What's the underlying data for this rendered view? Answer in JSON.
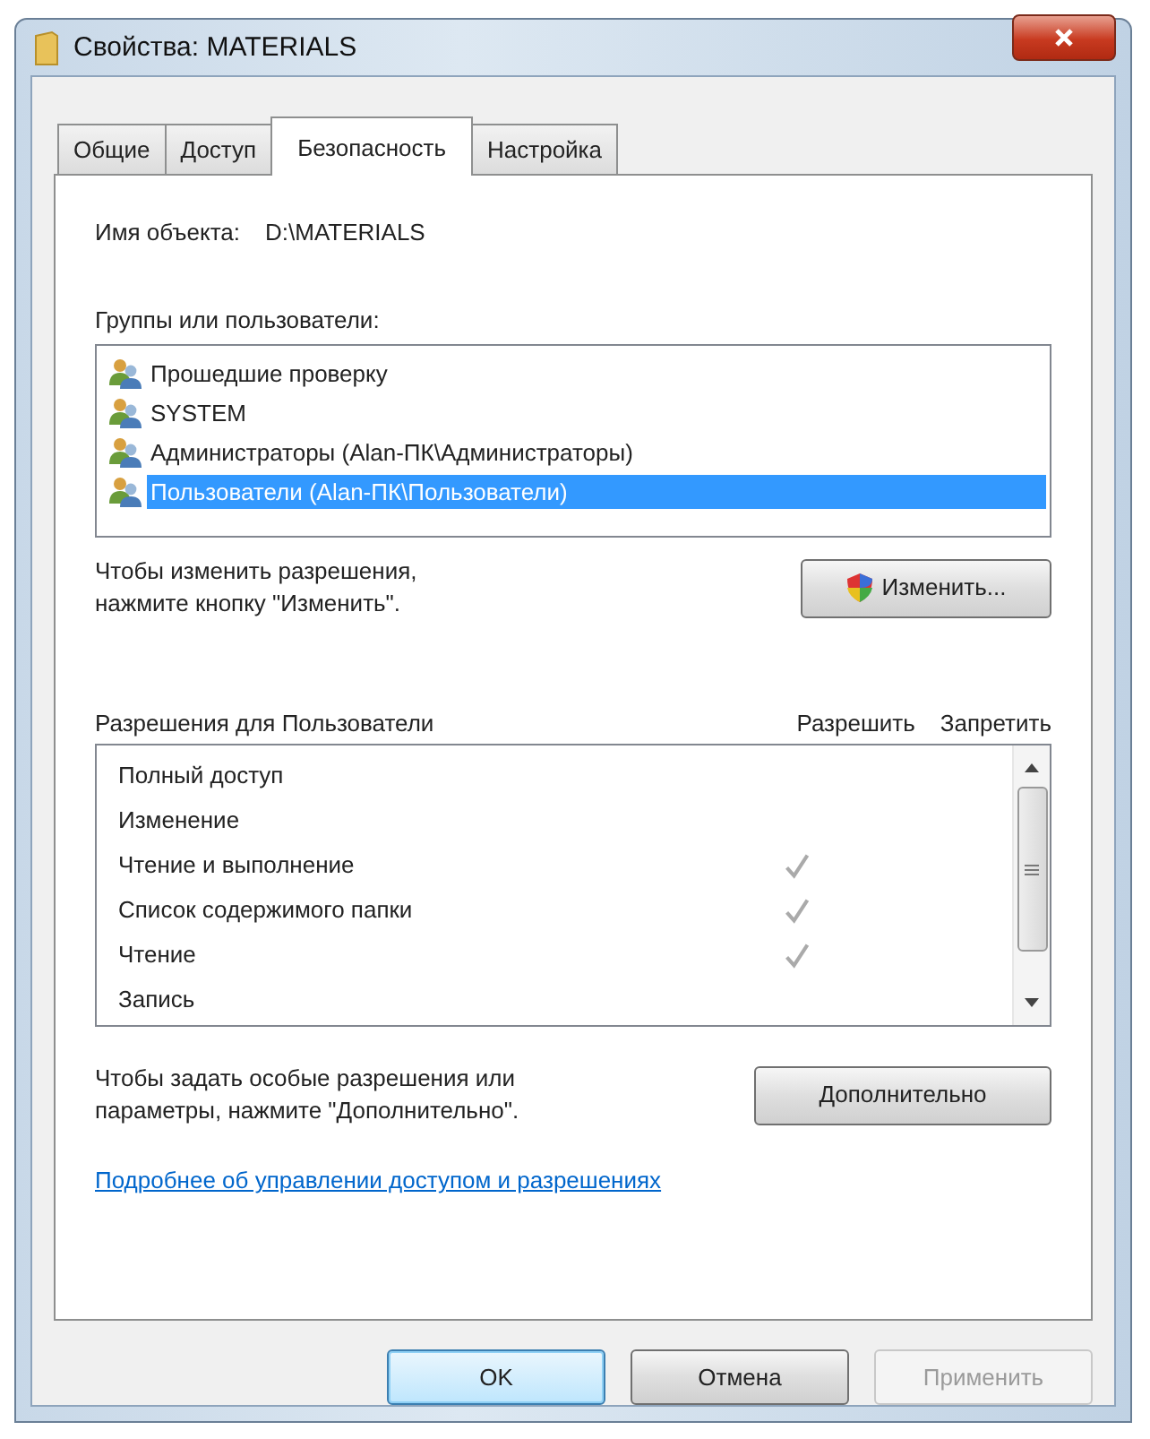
{
  "window": {
    "title": "Свойства: MATERIALS"
  },
  "tabs": [
    {
      "label": "Общие",
      "selected": false
    },
    {
      "label": "Доступ",
      "selected": false
    },
    {
      "label": "Безопасность",
      "selected": true
    },
    {
      "label": "Настройка",
      "selected": false
    }
  ],
  "object_name": {
    "label": "Имя объекта:",
    "value": "D:\\MATERIALS"
  },
  "groups": {
    "label": "Группы или пользователи:",
    "items": [
      {
        "name": "Прошедшие проверку",
        "selected": false
      },
      {
        "name": "SYSTEM",
        "selected": false
      },
      {
        "name": "Администраторы (Alan-ПК\\Администраторы)",
        "selected": false
      },
      {
        "name": "Пользователи (Alan-ПК\\Пользователи)",
        "selected": true
      }
    ]
  },
  "change_hint": "Чтобы изменить разрешения, нажмите кнопку \"Изменить\".",
  "change_button": "Изменить...",
  "permissions": {
    "label": "Разрешения для Пользователи",
    "allow_header": "Разрешить",
    "deny_header": "Запретить",
    "rows": [
      {
        "name": "Полный доступ",
        "allow": false
      },
      {
        "name": "Изменение",
        "allow": false
      },
      {
        "name": "Чтение и выполнение",
        "allow": true
      },
      {
        "name": "Список содержимого папки",
        "allow": true
      },
      {
        "name": "Чтение",
        "allow": true
      },
      {
        "name": "Запись",
        "allow": false
      }
    ]
  },
  "advanced_hint": "Чтобы задать особые разрешения или параметры, нажмите \"Дополнительно\".",
  "advanced_button": "Дополнительно",
  "help_link": "Подробнее об управлении доступом и разрешениях",
  "buttons": [
    {
      "label": "OK",
      "kind": "default",
      "disabled": false
    },
    {
      "label": "Отмена",
      "kind": "normal",
      "disabled": false
    },
    {
      "label": "Применить",
      "kind": "normal",
      "disabled": true
    }
  ]
}
